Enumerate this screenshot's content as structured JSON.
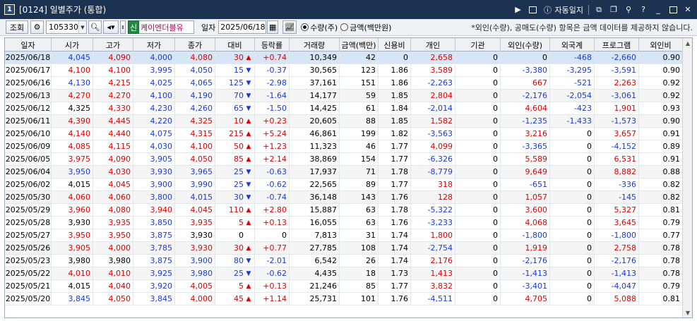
{
  "titlebar": {
    "num": "1",
    "title": "[0124] 일별주가 (통합)",
    "auto_label": "자동일지",
    "help": "?"
  },
  "toolbar": {
    "query_label": "조회",
    "code": "105330",
    "sin_badge": "신",
    "stock_name": "케이엔더블유",
    "date_label": "일자",
    "date_value": "2025/06/18",
    "radio_qty": "수량(주)",
    "radio_amt": "금액(백만원)",
    "notice": "*외인(수량), 공매도(수량) 항목은 금액 데이터를 제공하지 않습니다."
  },
  "colors": {
    "up": "#e00000",
    "down": "#1a3ad6",
    "selected": "#d6e6f7"
  },
  "table": {
    "headers": [
      "일자",
      "시가",
      "고가",
      "저가",
      "종가",
      "대비",
      "등락률",
      "거래량",
      "금액(백만)",
      "신용비",
      "개인",
      "기관",
      "외인(수량)",
      "외국계",
      "프로그램",
      "외인비"
    ],
    "rows": [
      {
        "d": "2025/06/18",
        "o": "4,045",
        "h": "4,090",
        "l": "4,000",
        "c": "4,080",
        "ch": "30",
        "dir": "up",
        "r": "+0.74",
        "v": "10,349",
        "amt": "42",
        "cr": "0",
        "ind": "2,658",
        "ins": "0",
        "fq": "0",
        "fg": "-468",
        "pg": "-2,660",
        "fr": "0.90",
        "oc": "dn",
        "hc": "up",
        "lc": "dn",
        "cc": "up",
        "sel": true
      },
      {
        "d": "2025/06/17",
        "o": "4,100",
        "h": "4,100",
        "l": "3,995",
        "c": "4,050",
        "ch": "15",
        "dir": "dn",
        "r": "-0.37",
        "v": "30,565",
        "amt": "123",
        "cr": "1.86",
        "ind": "3,589",
        "ins": "0",
        "fq": "-3,380",
        "fg": "-3,295",
        "pg": "-3,591",
        "fr": "0.90",
        "oc": "up",
        "hc": "up",
        "lc": "dn",
        "cc": "dn"
      },
      {
        "d": "2025/06/16",
        "o": "4,130",
        "h": "4,215",
        "l": "4,025",
        "c": "4,065",
        "ch": "125",
        "dir": "dn",
        "r": "-2.98",
        "v": "37,161",
        "amt": "151",
        "cr": "1.86",
        "ind": "-2,263",
        "ins": "0",
        "fq": "667",
        "fg": "-521",
        "pg": "2,263",
        "fr": "0.92",
        "oc": "dn",
        "hc": "up",
        "lc": "dn",
        "cc": "dn"
      },
      {
        "d": "2025/06/13",
        "o": "4,270",
        "h": "4,270",
        "l": "4,100",
        "c": "4,190",
        "ch": "70",
        "dir": "dn",
        "r": "-1.64",
        "v": "14,177",
        "amt": "59",
        "cr": "1.85",
        "ind": "2,804",
        "ins": "0",
        "fq": "-2,176",
        "fg": "-2,054",
        "pg": "-3,061",
        "fr": "0.92",
        "oc": "up",
        "hc": "up",
        "lc": "dn",
        "cc": "dn",
        "shade": true
      },
      {
        "d": "2025/06/12",
        "o": "4,325",
        "h": "4,330",
        "l": "4,230",
        "c": "4,260",
        "ch": "65",
        "dir": "dn",
        "r": "-1.50",
        "v": "14,425",
        "amt": "61",
        "cr": "1.84",
        "ind": "-2,014",
        "ins": "0",
        "fq": "4,604",
        "fg": "-423",
        "pg": "1,901",
        "fr": "0.93",
        "oc": "",
        "hc": "up",
        "lc": "dn",
        "cc": "dn"
      },
      {
        "d": "2025/06/11",
        "o": "4,390",
        "h": "4,445",
        "l": "4,220",
        "c": "4,325",
        "ch": "10",
        "dir": "up",
        "r": "+0.23",
        "v": "20,605",
        "amt": "88",
        "cr": "1.85",
        "ind": "1,582",
        "ins": "0",
        "fq": "-1,235",
        "fg": "-1,433",
        "pg": "-1,573",
        "fr": "0.90",
        "oc": "up",
        "hc": "up",
        "lc": "dn",
        "cc": "up",
        "shade": true
      },
      {
        "d": "2025/06/10",
        "o": "4,140",
        "h": "4,440",
        "l": "4,075",
        "c": "4,315",
        "ch": "215",
        "dir": "up",
        "r": "+5.24",
        "v": "46,861",
        "amt": "199",
        "cr": "1.82",
        "ind": "-3,563",
        "ins": "0",
        "fq": "3,216",
        "fg": "0",
        "pg": "3,657",
        "fr": "0.91",
        "oc": "up",
        "hc": "up",
        "lc": "dn",
        "cc": "up"
      },
      {
        "d": "2025/06/09",
        "o": "4,085",
        "h": "4,115",
        "l": "4,030",
        "c": "4,100",
        "ch": "50",
        "dir": "up",
        "r": "+1.23",
        "v": "11,323",
        "amt": "46",
        "cr": "1.77",
        "ind": "4,099",
        "ins": "0",
        "fq": "-3,365",
        "fg": "0",
        "pg": "-4,152",
        "fr": "0.89",
        "oc": "up",
        "hc": "up",
        "lc": "dn",
        "cc": "up"
      },
      {
        "d": "2025/06/05",
        "o": "3,975",
        "h": "4,090",
        "l": "3,905",
        "c": "4,050",
        "ch": "85",
        "dir": "up",
        "r": "+2.14",
        "v": "38,869",
        "amt": "154",
        "cr": "1.77",
        "ind": "-6,326",
        "ins": "0",
        "fq": "5,589",
        "fg": "0",
        "pg": "6,531",
        "fr": "0.91",
        "oc": "up",
        "hc": "up",
        "lc": "dn",
        "cc": "up"
      },
      {
        "d": "2025/06/04",
        "o": "3,950",
        "h": "4,030",
        "l": "3,930",
        "c": "3,965",
        "ch": "25",
        "dir": "dn",
        "r": "-0.63",
        "v": "17,937",
        "amt": "71",
        "cr": "1.78",
        "ind": "-8,779",
        "ins": "0",
        "fq": "9,649",
        "fg": "0",
        "pg": "8,882",
        "fr": "0.88",
        "oc": "dn",
        "hc": "up",
        "lc": "dn",
        "cc": "dn",
        "shade": true
      },
      {
        "d": "2025/06/02",
        "o": "4,015",
        "h": "4,045",
        "l": "3,900",
        "c": "3,990",
        "ch": "25",
        "dir": "dn",
        "r": "-0.62",
        "v": "22,565",
        "amt": "89",
        "cr": "1.77",
        "ind": "318",
        "ins": "0",
        "fq": "-651",
        "fg": "0",
        "pg": "-336",
        "fr": "0.82",
        "oc": "",
        "hc": "up",
        "lc": "dn",
        "cc": "dn"
      },
      {
        "d": "2025/05/30",
        "o": "4,060",
        "h": "4,060",
        "l": "3,800",
        "c": "4,015",
        "ch": "30",
        "dir": "dn",
        "r": "-0.74",
        "v": "36,148",
        "amt": "143",
        "cr": "1.76",
        "ind": "128",
        "ins": "0",
        "fq": "1,057",
        "fg": "0",
        "pg": "-145",
        "fr": "0.82",
        "oc": "up",
        "hc": "up",
        "lc": "dn",
        "cc": "dn",
        "shade": true
      },
      {
        "d": "2025/05/29",
        "o": "3,960",
        "h": "4,080",
        "l": "3,940",
        "c": "4,045",
        "ch": "110",
        "dir": "up",
        "r": "+2.80",
        "v": "15,887",
        "amt": "63",
        "cr": "1.78",
        "ind": "-5,322",
        "ins": "0",
        "fq": "3,600",
        "fg": "0",
        "pg": "5,327",
        "fr": "0.81",
        "oc": "up",
        "hc": "up",
        "lc": "up",
        "cc": "up"
      },
      {
        "d": "2025/05/28",
        "o": "3,930",
        "h": "3,935",
        "l": "3,850",
        "c": "3,935",
        "ch": "5",
        "dir": "up",
        "r": "+0.13",
        "v": "16,055",
        "amt": "63",
        "cr": "1.76",
        "ind": "-3,233",
        "ins": "0",
        "fq": "4,068",
        "fg": "0",
        "pg": "3,645",
        "fr": "0.79",
        "oc": "",
        "hc": "up",
        "lc": "dn",
        "cc": "up"
      },
      {
        "d": "2025/05/27",
        "o": "3,950",
        "h": "3,950",
        "l": "3,875",
        "c": "3,930",
        "ch": "0",
        "dir": "none",
        "r": "0",
        "v": "7,813",
        "amt": "31",
        "cr": "1.74",
        "ind": "1,800",
        "ins": "0",
        "fq": "-1,800",
        "fg": "0",
        "pg": "-1,800",
        "fr": "0.77",
        "oc": "up",
        "hc": "up",
        "lc": "dn",
        "cc": ""
      },
      {
        "d": "2025/05/26",
        "o": "3,905",
        "h": "4,000",
        "l": "3,785",
        "c": "3,930",
        "ch": "30",
        "dir": "up",
        "r": "+0.77",
        "v": "27,785",
        "amt": "108",
        "cr": "1.74",
        "ind": "-2,754",
        "ins": "0",
        "fq": "1,919",
        "fg": "0",
        "pg": "2,758",
        "fr": "0.78",
        "oc": "up",
        "hc": "up",
        "lc": "dn",
        "cc": "up",
        "shade": true
      },
      {
        "d": "2025/05/23",
        "o": "3,980",
        "h": "3,980",
        "l": "3,875",
        "c": "3,900",
        "ch": "80",
        "dir": "dn",
        "r": "-2.01",
        "v": "6,542",
        "amt": "26",
        "cr": "1.74",
        "ind": "2,176",
        "ins": "0",
        "fq": "-2,176",
        "fg": "0",
        "pg": "-2,176",
        "fr": "0.78",
        "oc": "",
        "hc": "",
        "lc": "dn",
        "cc": "dn"
      },
      {
        "d": "2025/05/22",
        "o": "4,010",
        "h": "4,010",
        "l": "3,925",
        "c": "3,980",
        "ch": "25",
        "dir": "dn",
        "r": "-0.62",
        "v": "4,435",
        "amt": "18",
        "cr": "1.73",
        "ind": "1,413",
        "ins": "0",
        "fq": "-1,413",
        "fg": "0",
        "pg": "-1,413",
        "fr": "0.78",
        "oc": "up",
        "hc": "up",
        "lc": "dn",
        "cc": "dn",
        "shade": true
      },
      {
        "d": "2025/05/21",
        "o": "4,015",
        "h": "4,040",
        "l": "3,920",
        "c": "4,005",
        "ch": "5",
        "dir": "up",
        "r": "+0.13",
        "v": "21,246",
        "amt": "85",
        "cr": "1.77",
        "ind": "3,832",
        "ins": "0",
        "fq": "-3,401",
        "fg": "0",
        "pg": "-4,047",
        "fr": "0.79",
        "oc": "",
        "hc": "up",
        "lc": "dn",
        "cc": "up"
      },
      {
        "d": "2025/05/20",
        "o": "3,845",
        "h": "4,050",
        "l": "3,845",
        "c": "4,000",
        "ch": "45",
        "dir": "up",
        "r": "+1.14",
        "v": "25,731",
        "amt": "101",
        "cr": "1.76",
        "ind": "-4,511",
        "ins": "0",
        "fq": "4,705",
        "fg": "0",
        "pg": "5,088",
        "fr": "0.81",
        "oc": "dn",
        "hc": "up",
        "lc": "dn",
        "cc": "up"
      }
    ]
  }
}
